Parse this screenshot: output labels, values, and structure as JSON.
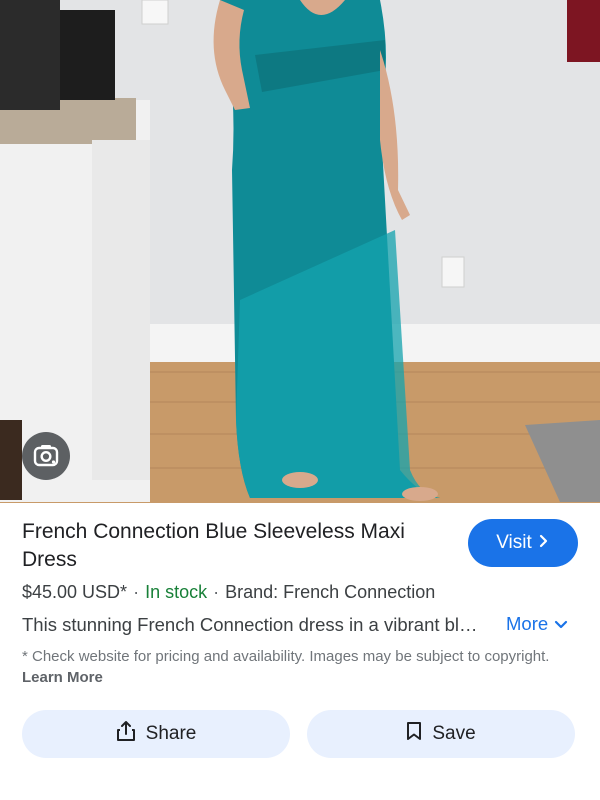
{
  "product": {
    "title": "French Connection Blue Sleeveless Maxi Dress",
    "price": "$45.00 USD*",
    "availability": "In stock",
    "brand": "Brand: French Connection",
    "description": "This stunning French Connection dress in a vibrant bl…",
    "more_label": "More",
    "disclaimer": "* Check website for pricing and availability. Images may be subject to copyright.",
    "learn_more_label": "Learn More"
  },
  "actions": {
    "visit_label": "Visit",
    "share_label": "Share",
    "save_label": "Save"
  },
  "icons": {
    "lens": "google-lens-icon",
    "visit_arrow": "chevron-right-icon",
    "more_arrow": "chevron-down-icon",
    "share": "share-icon",
    "save": "bookmark-icon"
  },
  "colors": {
    "accent": "#1a73e8",
    "stock": "#188038",
    "pill_bg": "#e8f0fe"
  }
}
